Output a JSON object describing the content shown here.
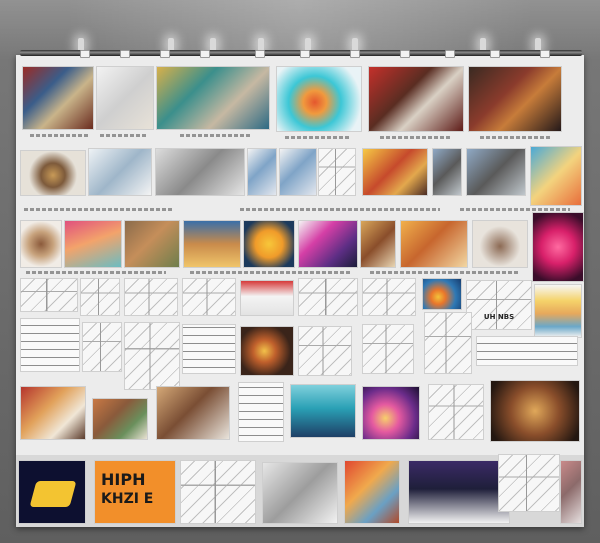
{
  "scene": {
    "wall_color": "#6b6b6b",
    "board_color": "#ececec"
  },
  "visible_text": {
    "poster_line_1": "HIPH",
    "poster_line_2": "KHZI E",
    "small_poster_label": "UH NBS"
  },
  "tiles": [
    {
      "name": "photo-tile-warm-desk",
      "style": "linear-gradient(135deg,#9b2b25 0%,#3a5d8a 35%,#c9b48a 60%,#6a2b1f 100%)"
    },
    {
      "name": "photo-tile-white-room",
      "style": "linear-gradient(135deg,#f2f2f2 0%,#cfcfcf 50%,#e8e2d8 100%)"
    },
    {
      "name": "photo-tile-collage-gold",
      "style": "linear-gradient(135deg,#d8b04a 0%,#3b8f8c 35%,#c6b8a2 65%,#2d6a84 100%)"
    },
    {
      "name": "photo-tile-cyan-abstract",
      "style": "radial-gradient(circle at 45% 55%,#e4572e 0%,#f09a3e 20%,#3cc7d6 45%,#e9f3f6 80%)"
    },
    {
      "name": "photo-tile-red-building",
      "style": "linear-gradient(135deg,#c4302b 0%,#5a2d22 40%,#d9d0c4 60%,#5e1c18 100%)"
    },
    {
      "name": "photo-tile-dark-interior",
      "style": "linear-gradient(135deg,#3a2a22 0%,#8a3b2c 40%,#c77c3a 60%,#24191a 100%)"
    },
    {
      "name": "photo-tile-hand-object",
      "style": "radial-gradient(circle at 50% 55%,#c89a57 0%,#7d5a3b 30%,#e6e1d8 60%)"
    },
    {
      "name": "photo-tile-sketch-building",
      "style": "linear-gradient(135deg,#eef2f5 0%,#9fb6c9 50%,#f4f4f4 100%)"
    },
    {
      "name": "photo-tile-grey-machine",
      "style": "linear-gradient(135deg,#dcdcdc 0%,#8a8a8a 50%,#e5e5e5 100%)"
    },
    {
      "name": "photo-tile-blue-figures",
      "style": "linear-gradient(135deg,#f3f3f3 0%,#7fa4c7 45%,#e3e7ee 100%)"
    },
    {
      "name": "photo-tile-bright-yellow",
      "style": "linear-gradient(135deg,#f6c945 0%,#c64a2c 45%,#e3a84d 70%,#4b2c25 100%)"
    },
    {
      "name": "photo-tile-cityscape-small",
      "style": "linear-gradient(135deg,#8fa9c5 0%,#5a5a5a 50%,#c0c7cc 100%)"
    },
    {
      "name": "photo-tile-blue-landscape",
      "style": "linear-gradient(135deg,#4aa9d6 0%,#f3d37e 50%,#e86e3b 100%)"
    },
    {
      "name": "photo-tile-teapot",
      "style": "radial-gradient(circle at 50% 50%,#8b5a3b 0%,#c7a27c 40%,#f1ece6 75%)"
    },
    {
      "name": "photo-tile-pink-mountain",
      "style": "linear-gradient(160deg,#e0507e 0%,#f3a36b 45%,#6bbcc2 100%)"
    },
    {
      "name": "photo-tile-outdoor-scene",
      "style": "linear-gradient(135deg,#8a6b4b 0%,#c58e5a 45%,#6e7e4c 100%)"
    },
    {
      "name": "photo-tile-city-towers",
      "style": "linear-gradient(180deg,#3a6fa8 0%,#c98b4b 50%,#f0c56a 100%)"
    },
    {
      "name": "photo-tile-yellow-face",
      "style": "radial-gradient(circle at 50% 50%,#f7c73a 0%,#f09b2a 40%,#1c3a5c 80%)"
    },
    {
      "name": "photo-tile-magenta-flower",
      "style": "linear-gradient(135deg,#f4f4f4 0%,#d53fa6 35%,#5c2e84 70%,#1d1d3a 100%)"
    },
    {
      "name": "photo-tile-warm-street",
      "style": "linear-gradient(135deg,#d9a65a 0%,#8a4e2b 50%,#e8d5b3 100%)"
    },
    {
      "name": "photo-tile-orange-sculpture",
      "style": "linear-gradient(135deg,#f1b04c 0%,#c7662e 45%,#f2d7a3 100%)"
    },
    {
      "name": "photo-tile-white-figure",
      "style": "radial-gradient(circle at 50% 55%,#8c6a54 0%,#e8e3dc 55%)"
    },
    {
      "name": "photo-tile-neon-pink",
      "style": "radial-gradient(circle at 50% 50%,#ff6aa0 0%,#d8206a 40%,#3a0d2a 85%)"
    },
    {
      "name": "photo-tile-red-poster",
      "style": "linear-gradient(180deg,#d63a3a 0%,#f4f4f4 45%,#e3e3e3 100%)"
    },
    {
      "name": "photo-tile-blue-yellow-art",
      "style": "radial-gradient(circle at 40% 60%,#f2c23a 0%,#e9762b 25%,#2f79b5 60%,#173c6e 100%)"
    },
    {
      "name": "photo-tile-coloured-chart",
      "style": "linear-gradient(180deg,#f6f6f6 0%,#f5d36a 30%,#e7a85c 55%,#6aa8c9 80%,#f0f0f0 100%)"
    },
    {
      "name": "photo-tile-spiral",
      "style": "radial-gradient(circle at 45% 50%,#f2c14a 0%,#c0602c 30%,#3a241a 70%)"
    },
    {
      "name": "photo-tile-red-building-low",
      "style": "linear-gradient(135deg,#b5352d 0%,#e1a15a 40%,#f0e6d6 70%,#5a3a2b 100%)"
    },
    {
      "name": "photo-tile-balloons",
      "style": "linear-gradient(135deg,#c97945 0%,#8a5a3b 40%,#6a8f5c 70%,#e9e2d4 100%)"
    },
    {
      "name": "photo-tile-room-interior",
      "style": "linear-gradient(135deg,#d4a877 0%,#7a4e34 45%,#e9e4dc 100%)"
    },
    {
      "name": "photo-tile-teal-horizon",
      "style": "linear-gradient(180deg,#7fd0dc 0%,#2aa0b5 45%,#1e3f66 100%)"
    },
    {
      "name": "photo-tile-purple-nebula",
      "style": "radial-gradient(circle at 40% 60%,#f7d06b 0%,#e55aa0 30%,#6b2c8a 65%,#1c1030 100%)"
    },
    {
      "name": "photo-tile-bronze-sculpture",
      "style": "radial-gradient(circle at 50% 50%,#e0a85a 0%,#8a4e2b 45%,#231711 90%)"
    },
    {
      "name": "photo-tile-grey-sketch",
      "style": "linear-gradient(135deg,#e6e6e6 0%,#9d9d9d 50%,#f2f2f2 100%)"
    },
    {
      "name": "photo-tile-orange-city",
      "style": "linear-gradient(135deg,#e0472f 0%,#f0a94d 40%,#6aa0c4 70%,#b04a2a 100%)"
    },
    {
      "name": "photo-tile-pink-room",
      "style": "linear-gradient(135deg,#c98a8a 0%,#8c6a6a 45%,#e5dede 100%)"
    },
    {
      "name": "photo-tile-city-night",
      "style": "linear-gradient(180deg,#3b2a66 0%,#1f1f3a 45%,#f2f2f2 100%)"
    }
  ]
}
